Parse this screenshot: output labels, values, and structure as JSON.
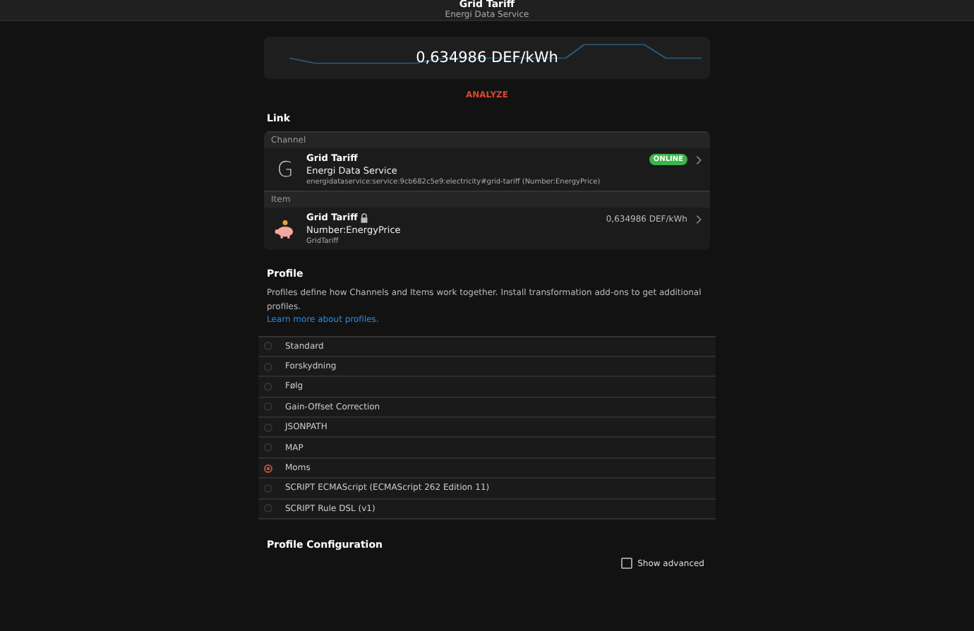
{
  "header": {
    "title": "Grid Tariff",
    "subtitle": "Energi Data Service"
  },
  "state_card": {
    "value": "0,634986 DEF/kWh"
  },
  "analyze_button": "ANALYZE",
  "link": {
    "heading": "Link",
    "channel": {
      "section": "Channel",
      "icon_letter": "G",
      "title": "Grid Tariff",
      "subtitle": "Energi Data Service",
      "uid": "energidataservice:service:9cb682c5e9:electricity#grid-tariff (Number:EnergyPrice)",
      "status": "ONLINE",
      "online": true
    },
    "item": {
      "section": "Item",
      "title": "Grid Tariff",
      "locked": true,
      "type": "Number:EnergyPrice",
      "name": "GridTariff",
      "state": "0,634986 DEF/kWh"
    }
  },
  "profile": {
    "heading": "Profile",
    "description": "Profiles define how Channels and Items work together. Install transformation add-ons to get additional profiles.",
    "link": "Learn more about profiles.",
    "options": [
      {
        "label": "Standard",
        "selected": false
      },
      {
        "label": "Forskydning",
        "selected": false
      },
      {
        "label": "Følg",
        "selected": false
      },
      {
        "label": "Gain-Offset Correction",
        "selected": false
      },
      {
        "label": "JSONPATH",
        "selected": false
      },
      {
        "label": "MAP",
        "selected": false
      },
      {
        "label": "Moms",
        "selected": true
      },
      {
        "label": "SCRIPT ECMAScript (ECMAScript 262 Edition 11)",
        "selected": false
      },
      {
        "label": "SCRIPT Rule DSL (v1)",
        "selected": false
      }
    ]
  },
  "profile_configuration": {
    "heading": "Profile Configuration",
    "show_advanced": {
      "label": "Show advanced",
      "checked": false
    }
  }
}
